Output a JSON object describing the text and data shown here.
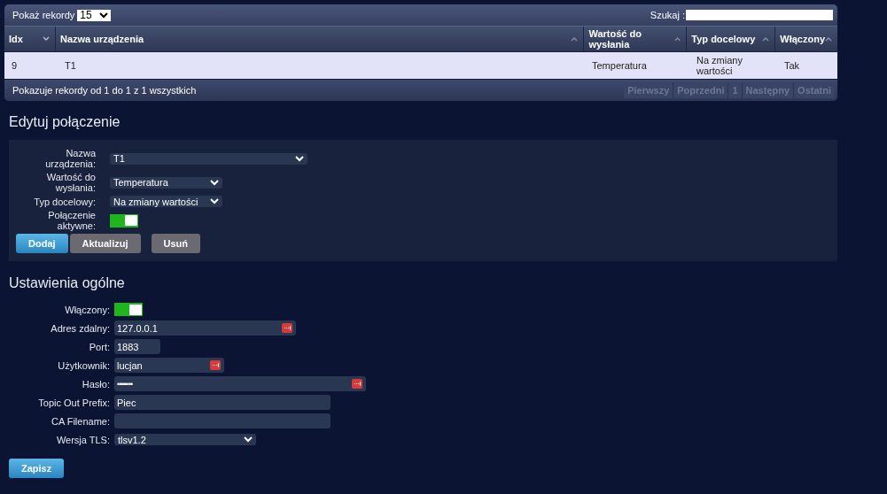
{
  "table": {
    "page_size_label": "Pokaż rekordy",
    "page_size": "15",
    "search_label": "Szukaj :",
    "columns": [
      {
        "label": "Idx",
        "sorted": true
      },
      {
        "label": "Nazwa urządzenia",
        "sorted": false
      },
      {
        "label": "Wartość do wysłania",
        "sorted": false
      },
      {
        "label": "Typ docelowy",
        "sorted": false
      },
      {
        "label": "Włączony",
        "sorted": false
      }
    ],
    "rows": [
      {
        "selected": true,
        "cells": [
          "9",
          "T1",
          "Temperatura",
          "Na zmiany wartości",
          "Tak"
        ]
      }
    ],
    "info": "Pokazuje rekordy od 1 do 1 z 1 wszystkich",
    "pagination": [
      {
        "label": "Pierwszy",
        "disabled": true
      },
      {
        "label": "Poprzedni",
        "disabled": true
      },
      {
        "label": "1",
        "disabled": true
      },
      {
        "label": "Następny",
        "disabled": true
      },
      {
        "label": "Ostatni",
        "disabled": true
      }
    ]
  },
  "edit": {
    "title": "Edytuj połączenie",
    "fields": [
      {
        "kind": "select",
        "label": "Nazwa urządzenia:",
        "value": "T1"
      },
      {
        "kind": "select",
        "label": "Wartość do wysłania:",
        "value": "Temperatura"
      },
      {
        "kind": "select",
        "label": "Typ docelowy:",
        "value": "Na zmiany wartości"
      },
      {
        "kind": "toggle",
        "label": "Połączenie aktywne:",
        "on": true
      }
    ],
    "buttons": [
      {
        "label": "Dodaj",
        "kind": "primary"
      },
      {
        "label": "Aktualizuj",
        "kind": "secondary"
      },
      {
        "label": "Usuń",
        "kind": "secondary"
      }
    ]
  },
  "settings": {
    "title": "Ustawienia ogólne",
    "fields": [
      {
        "kind": "toggle",
        "label": "Włączony:",
        "on": true
      },
      {
        "kind": "text",
        "label": "Adres zdalny:",
        "value": "127.0.0.1",
        "autofill_icon": true
      },
      {
        "kind": "text",
        "label": "Port:",
        "value": "1883",
        "autofill_icon": false
      },
      {
        "kind": "text",
        "label": "Użytkownik:",
        "value": "lucjan",
        "autofill_icon": true
      },
      {
        "kind": "password",
        "label": "Hasło:",
        "value": "••••••••",
        "autofill_icon": true
      },
      {
        "kind": "text",
        "label": "Topic Out Prefix:",
        "value": "Piec",
        "autofill_icon": false
      },
      {
        "kind": "text",
        "label": "CA Filename:",
        "autofill_icon": false
      },
      {
        "kind": "select",
        "label": "Wersja TLS:",
        "value": "tlsv1.2"
      }
    ],
    "save": "Zapisz"
  }
}
